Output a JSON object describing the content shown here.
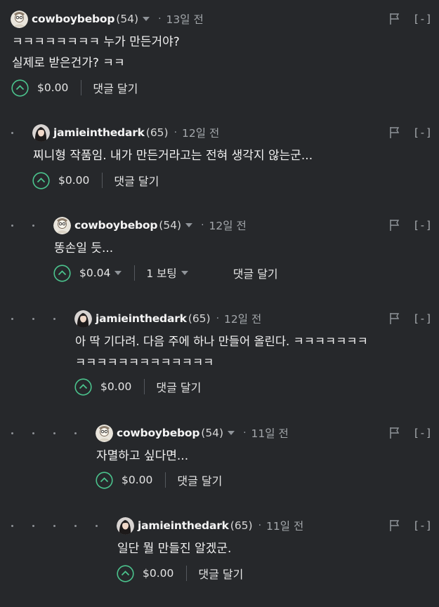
{
  "icons": {
    "upvote": "chevron-up-circle-icon",
    "flag": "flag-icon",
    "dropdown": "caret-down-icon",
    "avatar_cowboy": "avatar-cowboybebop",
    "avatar_jamie": "avatar-jamieinthedark"
  },
  "colors": {
    "background": "#26282b",
    "upvote_accent": "#4bc38d",
    "muted_text": "#a3a7ab"
  },
  "comments": [
    {
      "author": "cowboybebop",
      "reputation": "(54)",
      "time": "13일 전",
      "collapse_label": "[-]",
      "body_lines": [
        "ㅋㅋㅋㅋㅋㅋㅋㅋ 누가 만든거야?",
        "실제로 받은건가? ㅋㅋ"
      ],
      "payout": "$0.00",
      "reply_label": "댓글 달기"
    },
    {
      "author": "jamieinthedark",
      "reputation": "(65)",
      "time": "12일 전",
      "collapse_label": "[-]",
      "body_lines": [
        "찌니형 작품임. 내가 만든거라고는 전혀 생각지 않는군..."
      ],
      "payout": "$0.00",
      "reply_label": "댓글 달기"
    },
    {
      "author": "cowboybebop",
      "reputation": "(54)",
      "time": "12일 전",
      "collapse_label": "[-]",
      "body_lines": [
        "똥손일 듯..."
      ],
      "payout": "$0.04",
      "votes": "1 보팅",
      "reply_label": "댓글 달기"
    },
    {
      "author": "jamieinthedark",
      "reputation": "(65)",
      "time": "12일 전",
      "collapse_label": "[-]",
      "body_lines": [
        "아 딱 기다려. 다음 주에 하나 만들어 올린다. ㅋㅋㅋㅋㅋㅋㅋ",
        "ㅋㅋㅋㅋㅋㅋㅋㅋㅋㅋㅋㅋㅋ"
      ],
      "payout": "$0.00",
      "reply_label": "댓글 달기"
    },
    {
      "author": "cowboybebop",
      "reputation": "(54)",
      "time": "11일 전",
      "collapse_label": "[-]",
      "body_lines": [
        "자멸하고 싶다면..."
      ],
      "payout": "$0.00",
      "reply_label": "댓글 달기"
    },
    {
      "author": "jamieinthedark",
      "reputation": "(65)",
      "time": "11일 전",
      "collapse_label": "[-]",
      "body_lines": [
        "일단 뭘 만들진 알겠군."
      ],
      "payout": "$0.00",
      "reply_label": "댓글 달기"
    }
  ]
}
